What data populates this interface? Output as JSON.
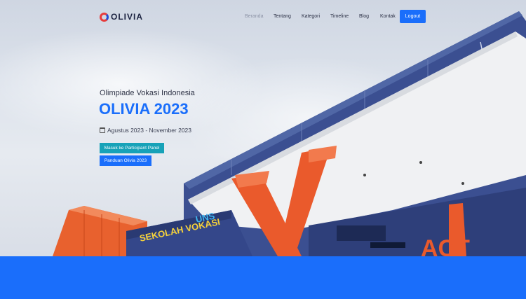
{
  "brand": {
    "name": "OLIVIA"
  },
  "nav": {
    "items": [
      {
        "label": "Beranda",
        "active": true
      },
      {
        "label": "Tentang"
      },
      {
        "label": "Kategori"
      },
      {
        "label": "Timeline"
      },
      {
        "label": "Blog"
      },
      {
        "label": "Kontak"
      }
    ],
    "logout_label": "Logout"
  },
  "hero": {
    "subtitle": "Olimpiade Vokasi Indonesia",
    "title": "OLIVIA 2023",
    "date_icon": "calendar-icon",
    "date_text": "Agustus 2023 - November 2023",
    "primary_button": "Masuk ke Participant Panel",
    "secondary_button": "Panduan Olivia 2023"
  },
  "colors": {
    "accent": "#1a6efb",
    "teal": "#17a2b8",
    "building_orange": "#ea5a2c",
    "building_blue": "#3b4f91"
  }
}
